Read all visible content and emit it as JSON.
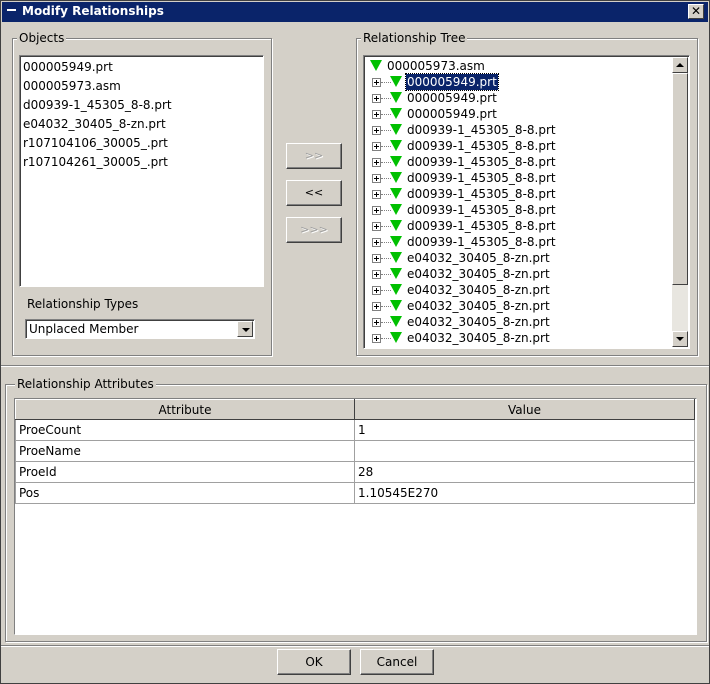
{
  "window": {
    "title": "Modify Relationships"
  },
  "objects": {
    "label": "Objects",
    "items": [
      "000005949.prt",
      "000005973.asm",
      "d00939-1_45305_8-8.prt",
      "e04032_30405_8-zn.prt",
      "r107104106_30005_.prt",
      "r107104261_30005_.prt"
    ]
  },
  "relationship_types": {
    "label": "Relationship Types",
    "selected": "Unplaced Member"
  },
  "transfer_buttons": {
    "add": ">>",
    "remove": "<<",
    "add_all": ">>>"
  },
  "tree": {
    "label": "Relationship Tree",
    "root": "000005973.asm",
    "nodes": [
      "000005949.prt",
      "000005949.prt",
      "000005949.prt",
      "d00939-1_45305_8-8.prt",
      "d00939-1_45305_8-8.prt",
      "d00939-1_45305_8-8.prt",
      "d00939-1_45305_8-8.prt",
      "d00939-1_45305_8-8.prt",
      "d00939-1_45305_8-8.prt",
      "d00939-1_45305_8-8.prt",
      "d00939-1_45305_8-8.prt",
      "e04032_30405_8-zn.prt",
      "e04032_30405_8-zn.prt",
      "e04032_30405_8-zn.prt",
      "e04032_30405_8-zn.prt",
      "e04032_30405_8-zn.prt",
      "e04032_30405_8-zn.prt"
    ],
    "selected_index": 0
  },
  "attributes": {
    "label": "Relationship Attributes",
    "columns": [
      "Attribute",
      "Value"
    ],
    "rows": [
      [
        "ProeCount",
        "1"
      ],
      [
        "ProeName",
        ""
      ],
      [
        "ProeId",
        "28"
      ],
      [
        "Pos",
        "1.10545E270"
      ]
    ]
  },
  "footer": {
    "ok": "OK",
    "cancel": "Cancel"
  },
  "colors": {
    "titlebar": "#0a246a",
    "tree_icon": "#00c000",
    "selection": "#0a246a"
  }
}
